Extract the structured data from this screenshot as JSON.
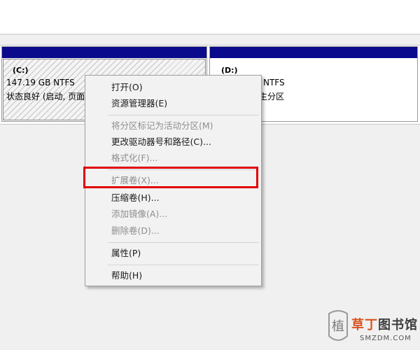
{
  "disk": {
    "c": {
      "letter": "(C:)",
      "size": "147.19 GB NTFS",
      "status": "状态良好 (启动, 页面"
    },
    "d": {
      "letter": "(D:)",
      "size": "NTFS",
      "status": "主分区"
    }
  },
  "context_menu": {
    "items": [
      {
        "label": "打开(O)",
        "enabled": true
      },
      {
        "label": "资源管理器(E)",
        "enabled": true
      },
      {
        "label": "将分区标记为活动分区(M)",
        "enabled": false
      },
      {
        "label": "更改驱动器号和路径(C)...",
        "enabled": true
      },
      {
        "label": "格式化(F)...",
        "enabled": false
      },
      {
        "label": "扩展卷(X)...",
        "enabled": false
      },
      {
        "label": "压缩卷(H)...",
        "enabled": true
      },
      {
        "label": "添加镜像(A)...",
        "enabled": false
      },
      {
        "label": "删除卷(D)...",
        "enabled": false
      },
      {
        "label": "属性(P)",
        "enabled": true
      },
      {
        "label": "帮助(H)",
        "enabled": true
      }
    ]
  },
  "annotation": {
    "color": "#e00000"
  },
  "watermark": {
    "title_part1": "草丁",
    "title_part2": "图书馆",
    "site": "SMZDM.COM",
    "logo_char": "植"
  }
}
